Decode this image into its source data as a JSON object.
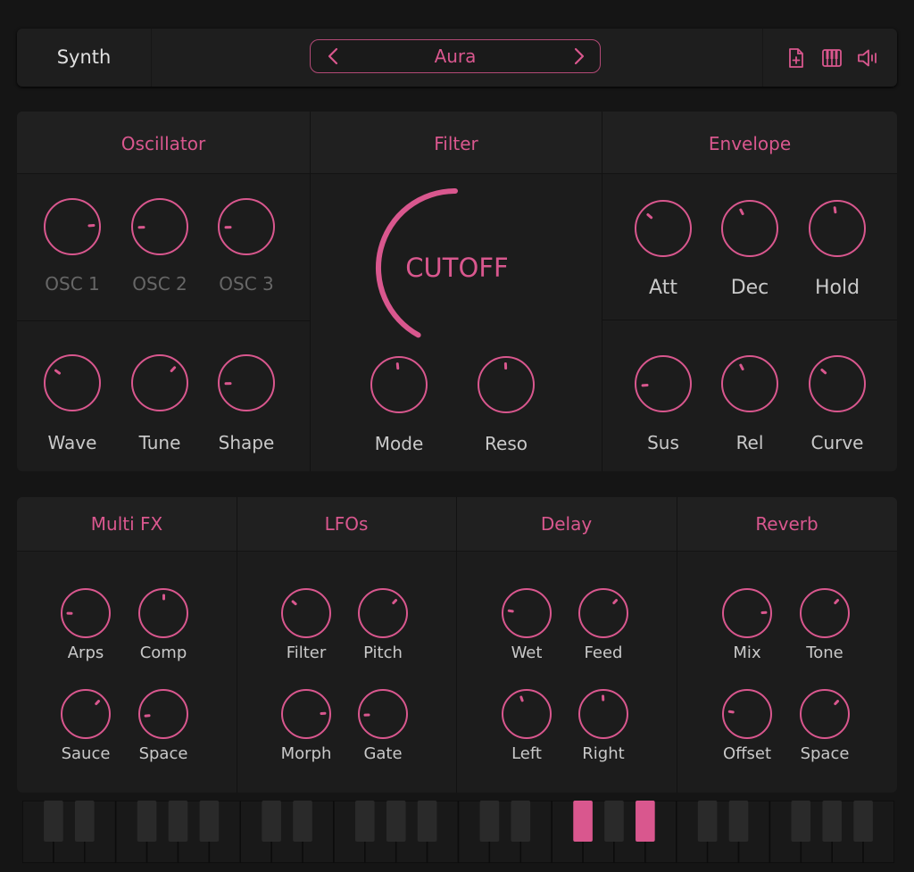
{
  "app": {
    "name": "Synth",
    "preset": "Aura"
  },
  "icons": {
    "prev": "chevron-left-icon",
    "next": "chevron-right-icon",
    "new_file": "new-file-icon",
    "keyboard": "piano-keyboard-icon",
    "speaker": "speaker-icon"
  },
  "colors": {
    "accent": "#d9578e",
    "panel": "#1c1c1c",
    "background": "#151515"
  },
  "oscillator": {
    "title": "Oscillator",
    "row1": [
      {
        "label": "OSC 1",
        "value": 0.82
      },
      {
        "label": "OSC 2",
        "value": 0.16
      },
      {
        "label": "OSC 3",
        "value": 0.16
      }
    ],
    "row2": [
      {
        "label": "Wave",
        "value": 0.3
      },
      {
        "label": "Tune",
        "value": 0.66
      },
      {
        "label": "Shape",
        "value": 0.16
      }
    ]
  },
  "filter": {
    "title": "Filter",
    "cutoff": {
      "label": "CUTOFF",
      "value": 0.42
    },
    "knobs": [
      {
        "label": "Mode",
        "value": 0.48
      },
      {
        "label": "Reso",
        "value": 0.49
      }
    ]
  },
  "envelope": {
    "title": "Envelope",
    "row1": [
      {
        "label": "Att",
        "value": 0.32
      },
      {
        "label": "Dec",
        "value": 0.4
      },
      {
        "label": "Hold",
        "value": 0.47
      }
    ],
    "row2": [
      {
        "label": "Sus",
        "value": 0.15
      },
      {
        "label": "Rel",
        "value": 0.4
      },
      {
        "label": "Curve",
        "value": 0.32
      }
    ]
  },
  "multi_fx": {
    "title": "Multi FX",
    "row1": [
      {
        "label": "Arps",
        "value": 0.17
      },
      {
        "label": "Comp",
        "value": 0.5
      }
    ],
    "row2": [
      {
        "label": "Sauce",
        "value": 0.66
      },
      {
        "label": "Space",
        "value": 0.15
      }
    ]
  },
  "lfos": {
    "title": "LFOs",
    "row1": [
      {
        "label": "Filter",
        "value": 0.32
      },
      {
        "label": "Pitch",
        "value": 0.66
      }
    ],
    "row2": [
      {
        "label": "Morph",
        "value": 0.82
      },
      {
        "label": "Gate",
        "value": 0.16
      }
    ]
  },
  "delay": {
    "title": "Delay",
    "row1": [
      {
        "label": "Wet",
        "value": 0.2
      },
      {
        "label": "Feed",
        "value": 0.66
      }
    ],
    "row2": [
      {
        "label": "Left",
        "value": 0.43
      },
      {
        "label": "Right",
        "value": 0.49
      }
    ]
  },
  "reverb": {
    "title": "Reverb",
    "row1": [
      {
        "label": "Mix",
        "value": 0.82
      },
      {
        "label": "Tone",
        "value": 0.66
      }
    ],
    "row2": [
      {
        "label": "Offset",
        "value": 0.2
      },
      {
        "label": "Space",
        "value": 0.66
      }
    ]
  },
  "keyboard": {
    "active_keys": [
      "F#4",
      "A#4"
    ]
  }
}
